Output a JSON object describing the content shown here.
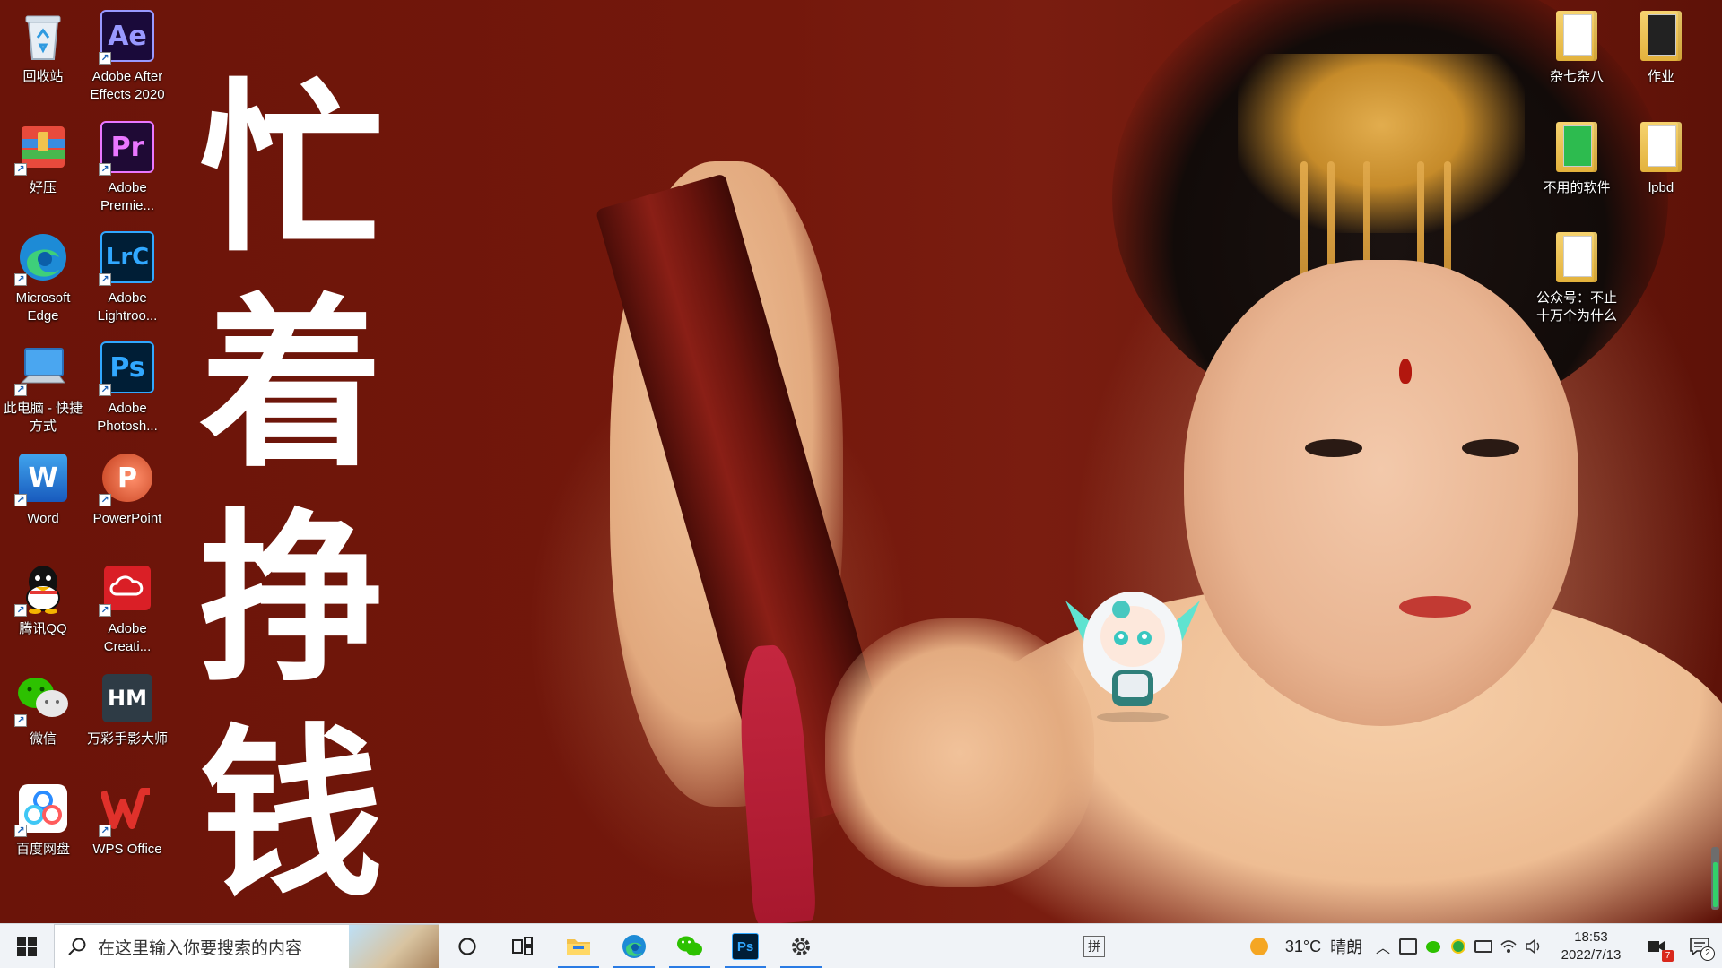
{
  "wallpaper": {
    "text_chars": [
      "忙",
      "着",
      "挣",
      "钱"
    ]
  },
  "desktop": {
    "left_icons": [
      {
        "label": "回收站",
        "icon": "recycle-bin-icon"
      },
      {
        "label": "Adobe After Effects 2020",
        "icon": "after-effects-icon",
        "abbr": "Ae"
      },
      {
        "label": "好压",
        "icon": "haozip-icon"
      },
      {
        "label": "Adobe Premie...",
        "icon": "premiere-icon",
        "abbr": "Pr"
      },
      {
        "label": "Microsoft Edge",
        "icon": "edge-icon"
      },
      {
        "label": "Adobe Lightroo...",
        "icon": "lightroom-icon",
        "abbr": "LrC"
      },
      {
        "label": "此电脑 - 快捷方式",
        "icon": "this-pc-icon"
      },
      {
        "label": "Adobe Photosh...",
        "icon": "photoshop-icon",
        "abbr": "Ps"
      },
      {
        "label": "Word",
        "icon": "word-icon",
        "abbr": "W"
      },
      {
        "label": "PowerPoint",
        "icon": "powerpoint-icon",
        "abbr": "P"
      },
      {
        "label": "腾讯QQ",
        "icon": "qq-icon"
      },
      {
        "label": "Adobe Creati...",
        "icon": "creative-cloud-icon"
      },
      {
        "label": "微信",
        "icon": "wechat-icon"
      },
      {
        "label": "万彩手影大师",
        "icon": "wancai-icon",
        "abbr": "HM"
      },
      {
        "label": "百度网盘",
        "icon": "baidu-netdisk-icon"
      },
      {
        "label": "WPS Office",
        "icon": "wps-icon",
        "abbr": "W"
      }
    ],
    "right_icons": [
      {
        "label": "杂七杂八",
        "icon": "folder-icon"
      },
      {
        "label": "作业",
        "icon": "folder-icon"
      },
      {
        "label": "不用的软件",
        "icon": "folder-icon"
      },
      {
        "label": "lpbd",
        "icon": "folder-icon"
      },
      {
        "label": "公众号：不止十万个为什么",
        "icon": "folder-icon"
      }
    ]
  },
  "taskbar": {
    "search_placeholder": "在这里输入你要搜索的内容",
    "pinned": [
      {
        "name": "cortana",
        "icon": "cortana-icon"
      },
      {
        "name": "task-view",
        "icon": "task-view-icon"
      },
      {
        "name": "file-explorer",
        "icon": "folder-icon",
        "running": true
      },
      {
        "name": "edge",
        "icon": "edge-icon",
        "running": true
      },
      {
        "name": "wechat",
        "icon": "wechat-icon",
        "running": true
      },
      {
        "name": "photoshop",
        "icon": "photoshop-icon",
        "label": "Ps",
        "running": true
      },
      {
        "name": "settings",
        "icon": "gear-icon",
        "running": true
      }
    ],
    "ime": "拼",
    "weather": {
      "temp": "31°C",
      "desc": "晴朗"
    },
    "clock": {
      "time": "18:53",
      "date": "2022/7/13"
    },
    "notifications_badge": "7",
    "action_center_badge": "2"
  },
  "colors": {
    "wallpaper_bg": "#6e160d",
    "taskbar_bg": "#f0f3f7",
    "accent": "#2a7be4"
  }
}
